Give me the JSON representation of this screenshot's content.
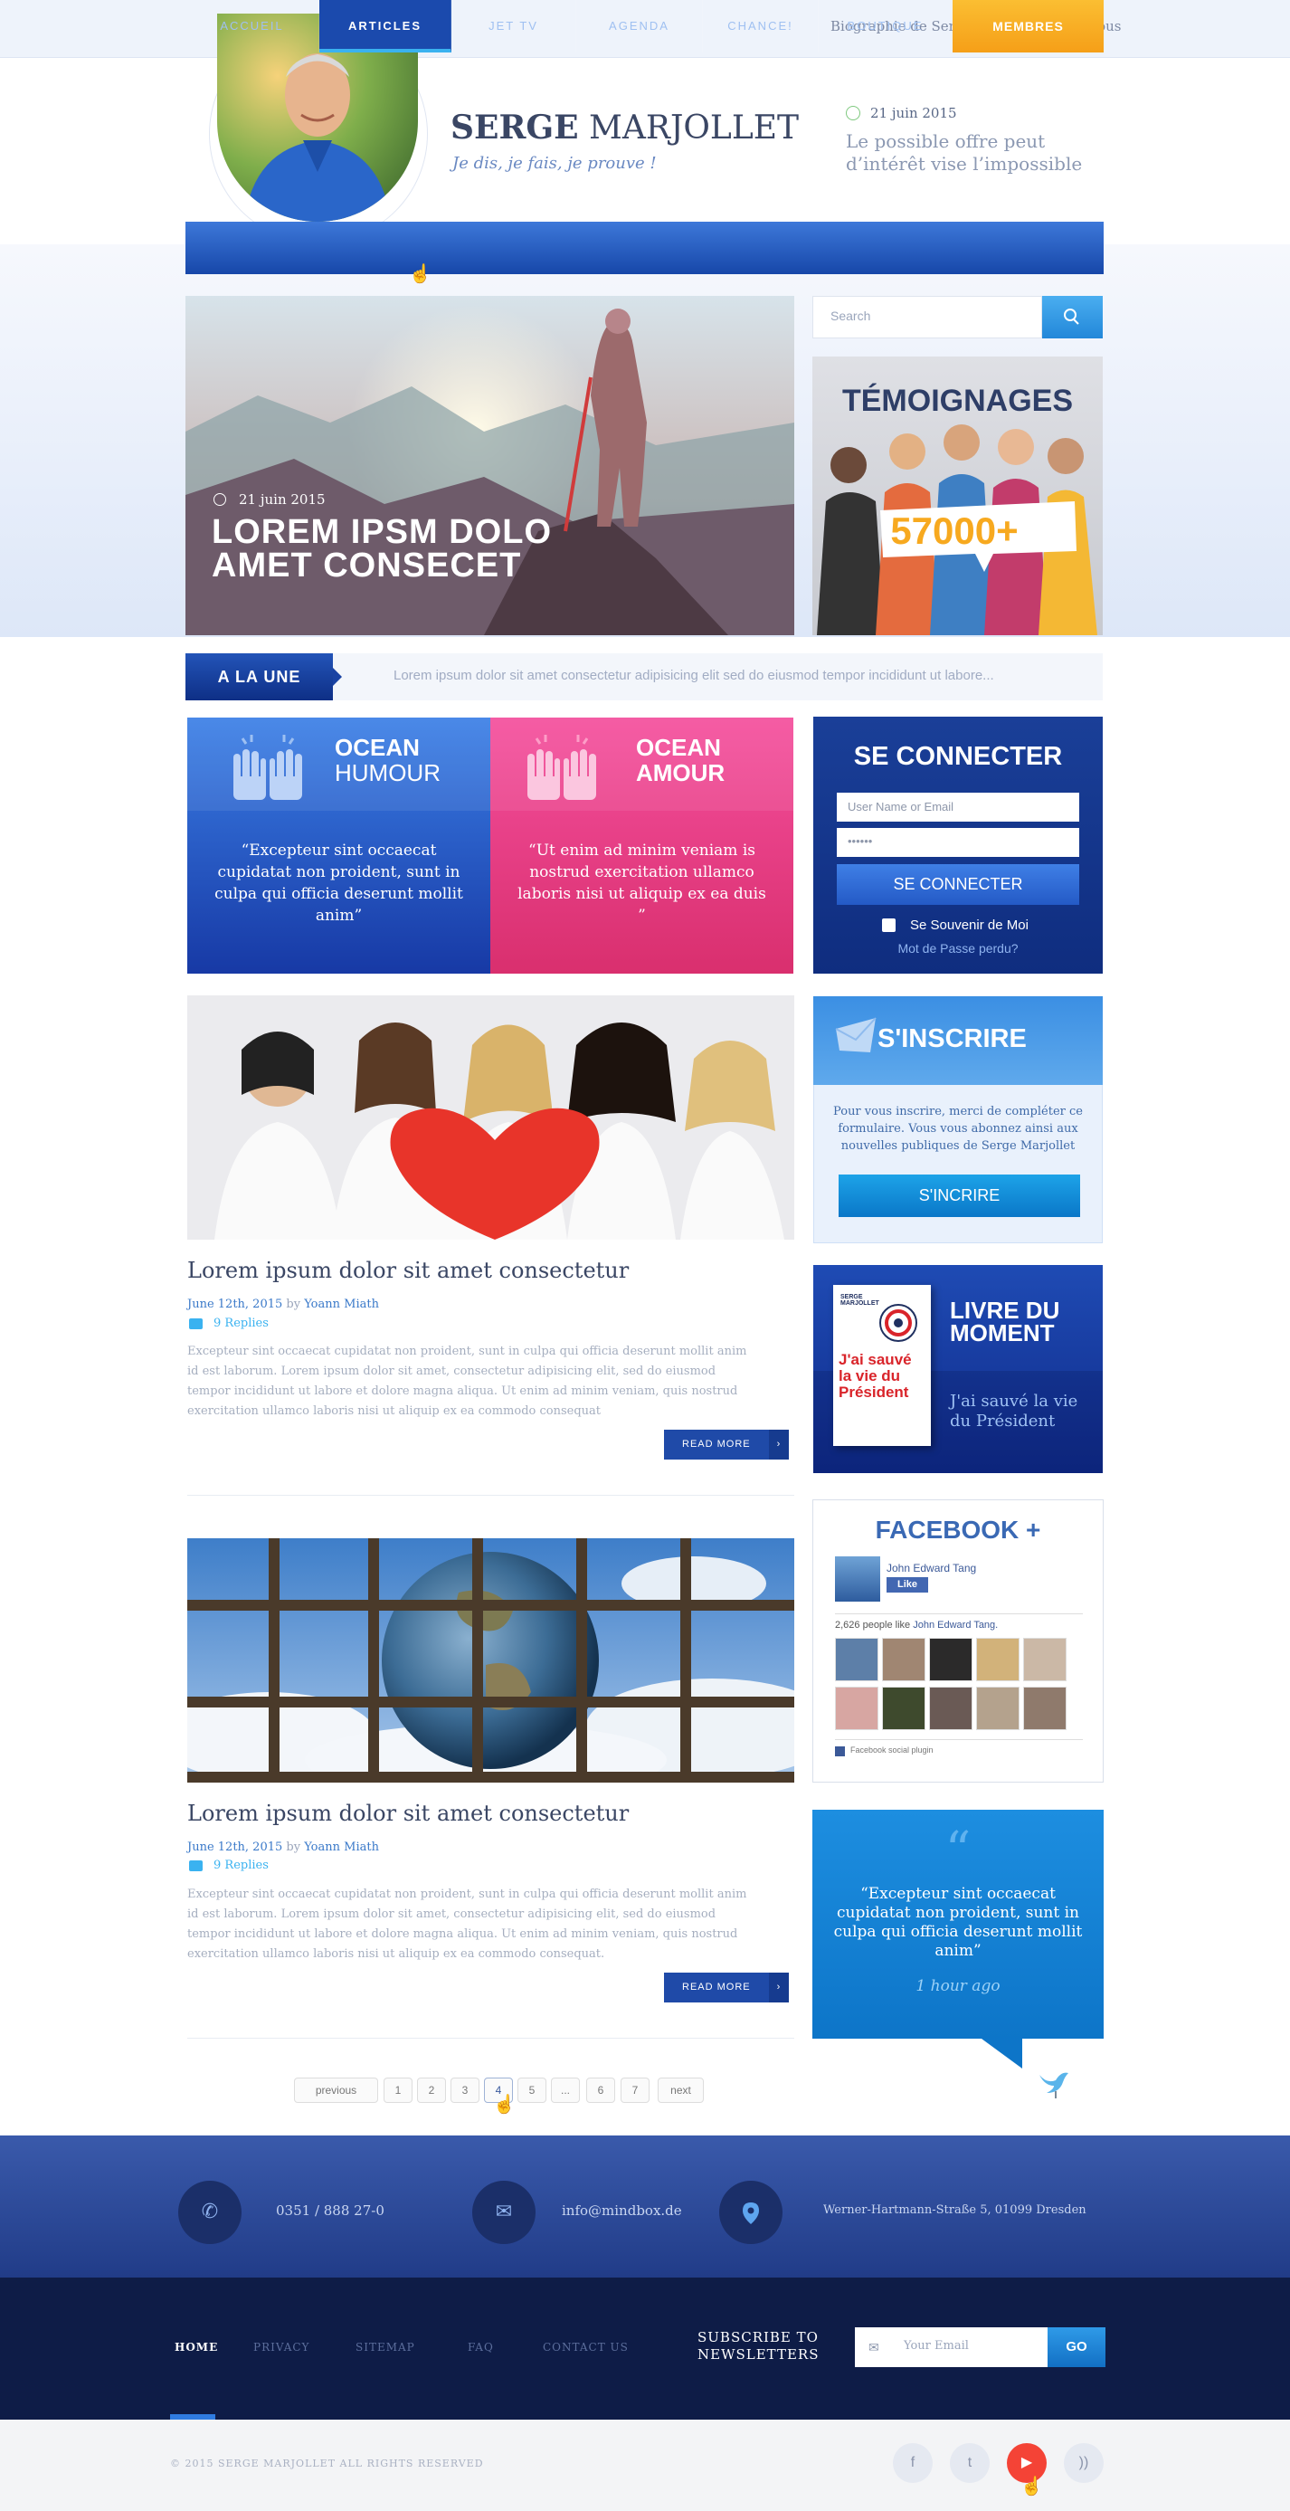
{
  "topbar": {
    "biography": "Biographie de Serge",
    "contact": "Contactez-nous"
  },
  "header": {
    "name_first": "SERGE",
    "name_last": "MARJOLLET",
    "tagline": "Je dis, je fais, je prouve !",
    "date": "21 juin 2015",
    "quote": "Le possible offre peut d’intérêt vise l’impossible"
  },
  "nav": {
    "items": [
      "ACCUEIL",
      "ARTICLES",
      "JET TV",
      "AGENDA",
      "CHANCE!",
      "BOUTIQUE"
    ],
    "members": "MEMBRES"
  },
  "hero": {
    "date": "21 juin 2015",
    "title_line1": "LOREM IPSM DOLO",
    "title_line2": "AMET CONSECET"
  },
  "search": {
    "placeholder": "Search"
  },
  "testimonials": {
    "title": "TÉMOIGNAGES",
    "count": "57000+"
  },
  "une": {
    "label": "A LA UNE",
    "text": "Lorem ipsum dolor sit amet consectetur adipisicing elit sed do eiusmod tempor incididunt ut labore..."
  },
  "ocean": [
    {
      "title1": "OCEAN",
      "title2": "HUMOUR",
      "quote": "“Excepteur sint occaecat cupidatat non proident, sunt in culpa qui officia deserunt mollit anim”"
    },
    {
      "title1": "OCEAN",
      "title2": "AMOUR",
      "quote": "“Ut enim ad minim veniam is nostrud exercitation ullamco laboris nisi ut aliquip ex ea  duis ”"
    }
  ],
  "login": {
    "title": "SE CONNECTER",
    "user_placeholder": "User Name or Email",
    "password_placeholder": "••••••",
    "button": "SE CONNECTER",
    "remember": "Se Souvenir de Moi",
    "forgot": "Mot de Passe perdu?"
  },
  "posts": [
    {
      "title": "Lorem ipsum dolor sit amet consectetur",
      "date": "June 12th, 2015",
      "by": "by",
      "author": "Yoann Miath",
      "replies": "9 Replies",
      "body": "Excepteur sint occaecat cupidatat non proident, sunt in culpa qui officia deserunt mollit anim id est laborum. Lorem ipsum dolor sit amet, consectetur adipisicing elit, sed do eiusmod tempor incididunt ut labore et dolore magna aliqua. Ut enim ad minim veniam, quis nostrud exercitation ullamco laboris nisi ut aliquip ex ea commodo consequat",
      "more": "READ MORE"
    },
    {
      "title": "Lorem ipsum dolor sit amet consectetur",
      "date": "June 12th, 2015",
      "by": "by",
      "author": "Yoann Miath",
      "replies": "9 Replies",
      "body": "Excepteur sint occaecat cupidatat non proident, sunt in culpa qui officia deserunt mollit anim id est laborum. Lorem ipsum dolor sit amet, consectetur adipisicing elit, sed do eiusmod tempor incididunt ut labore et dolore magna aliqua. Ut enim ad minim veniam, quis nostrud exercitation ullamco laboris nisi ut aliquip ex ea commodo consequat.",
      "more": "READ MORE"
    }
  ],
  "signup": {
    "title": "S'INSCRIRE",
    "text": "Pour vous inscrire, merci de compléter ce formulaire. Vous vous abonnez ainsi aux nouvelles publiques de Serge Marjollet",
    "button": "S'INCRIRE"
  },
  "book": {
    "title1": "LIVRE DU",
    "title2": "MOMENT",
    "subtitle": "J'ai sauvé la vie du Président",
    "cover_author": "SERGE MARJOLLET",
    "cover_title": "J'ai sauvé la vie du Président"
  },
  "facebook": {
    "title": "FACEBOOK +",
    "user": "John Edward Tang",
    "like": "Like",
    "count_text": "2,626 people like",
    "count_user": "John Edward Tang.",
    "plugin": "Facebook social plugin"
  },
  "tweet": {
    "quote": "“Excepteur sint occaecat cupidatat non proident, sunt in culpa qui officia deserunt mollit anim”",
    "time": "1 hour ago"
  },
  "pagination": {
    "previous": "previous",
    "pages": [
      "1",
      "2",
      "3",
      "4",
      "5",
      "...",
      "6",
      "7"
    ],
    "next": "next",
    "current": "4"
  },
  "contact": {
    "phone": "0351 / 888 27-0",
    "email": "info@mindbox.de",
    "address": "Werner-Hartmann-Straße 5, 01099 Dresden"
  },
  "footer_nav": [
    "HOME",
    "PRIVACY",
    "SITEMAP",
    "FAQ",
    "CONTACT US"
  ],
  "newsletter": {
    "label_line1": "SUBSCRIBE TO",
    "label_line2": "NEWSLETTERS",
    "placeholder": "Your Email",
    "button": "GO"
  },
  "copyright": "© 2015 SERGE MARJOLLET ALL RIGHTS RESERVED",
  "colors": {
    "primary": "#1c4db0",
    "accent_orange": "#f7a91f",
    "accent_pink": "#e83f86",
    "footer_dark": "#0e1c47",
    "youtube": "#f44336"
  }
}
